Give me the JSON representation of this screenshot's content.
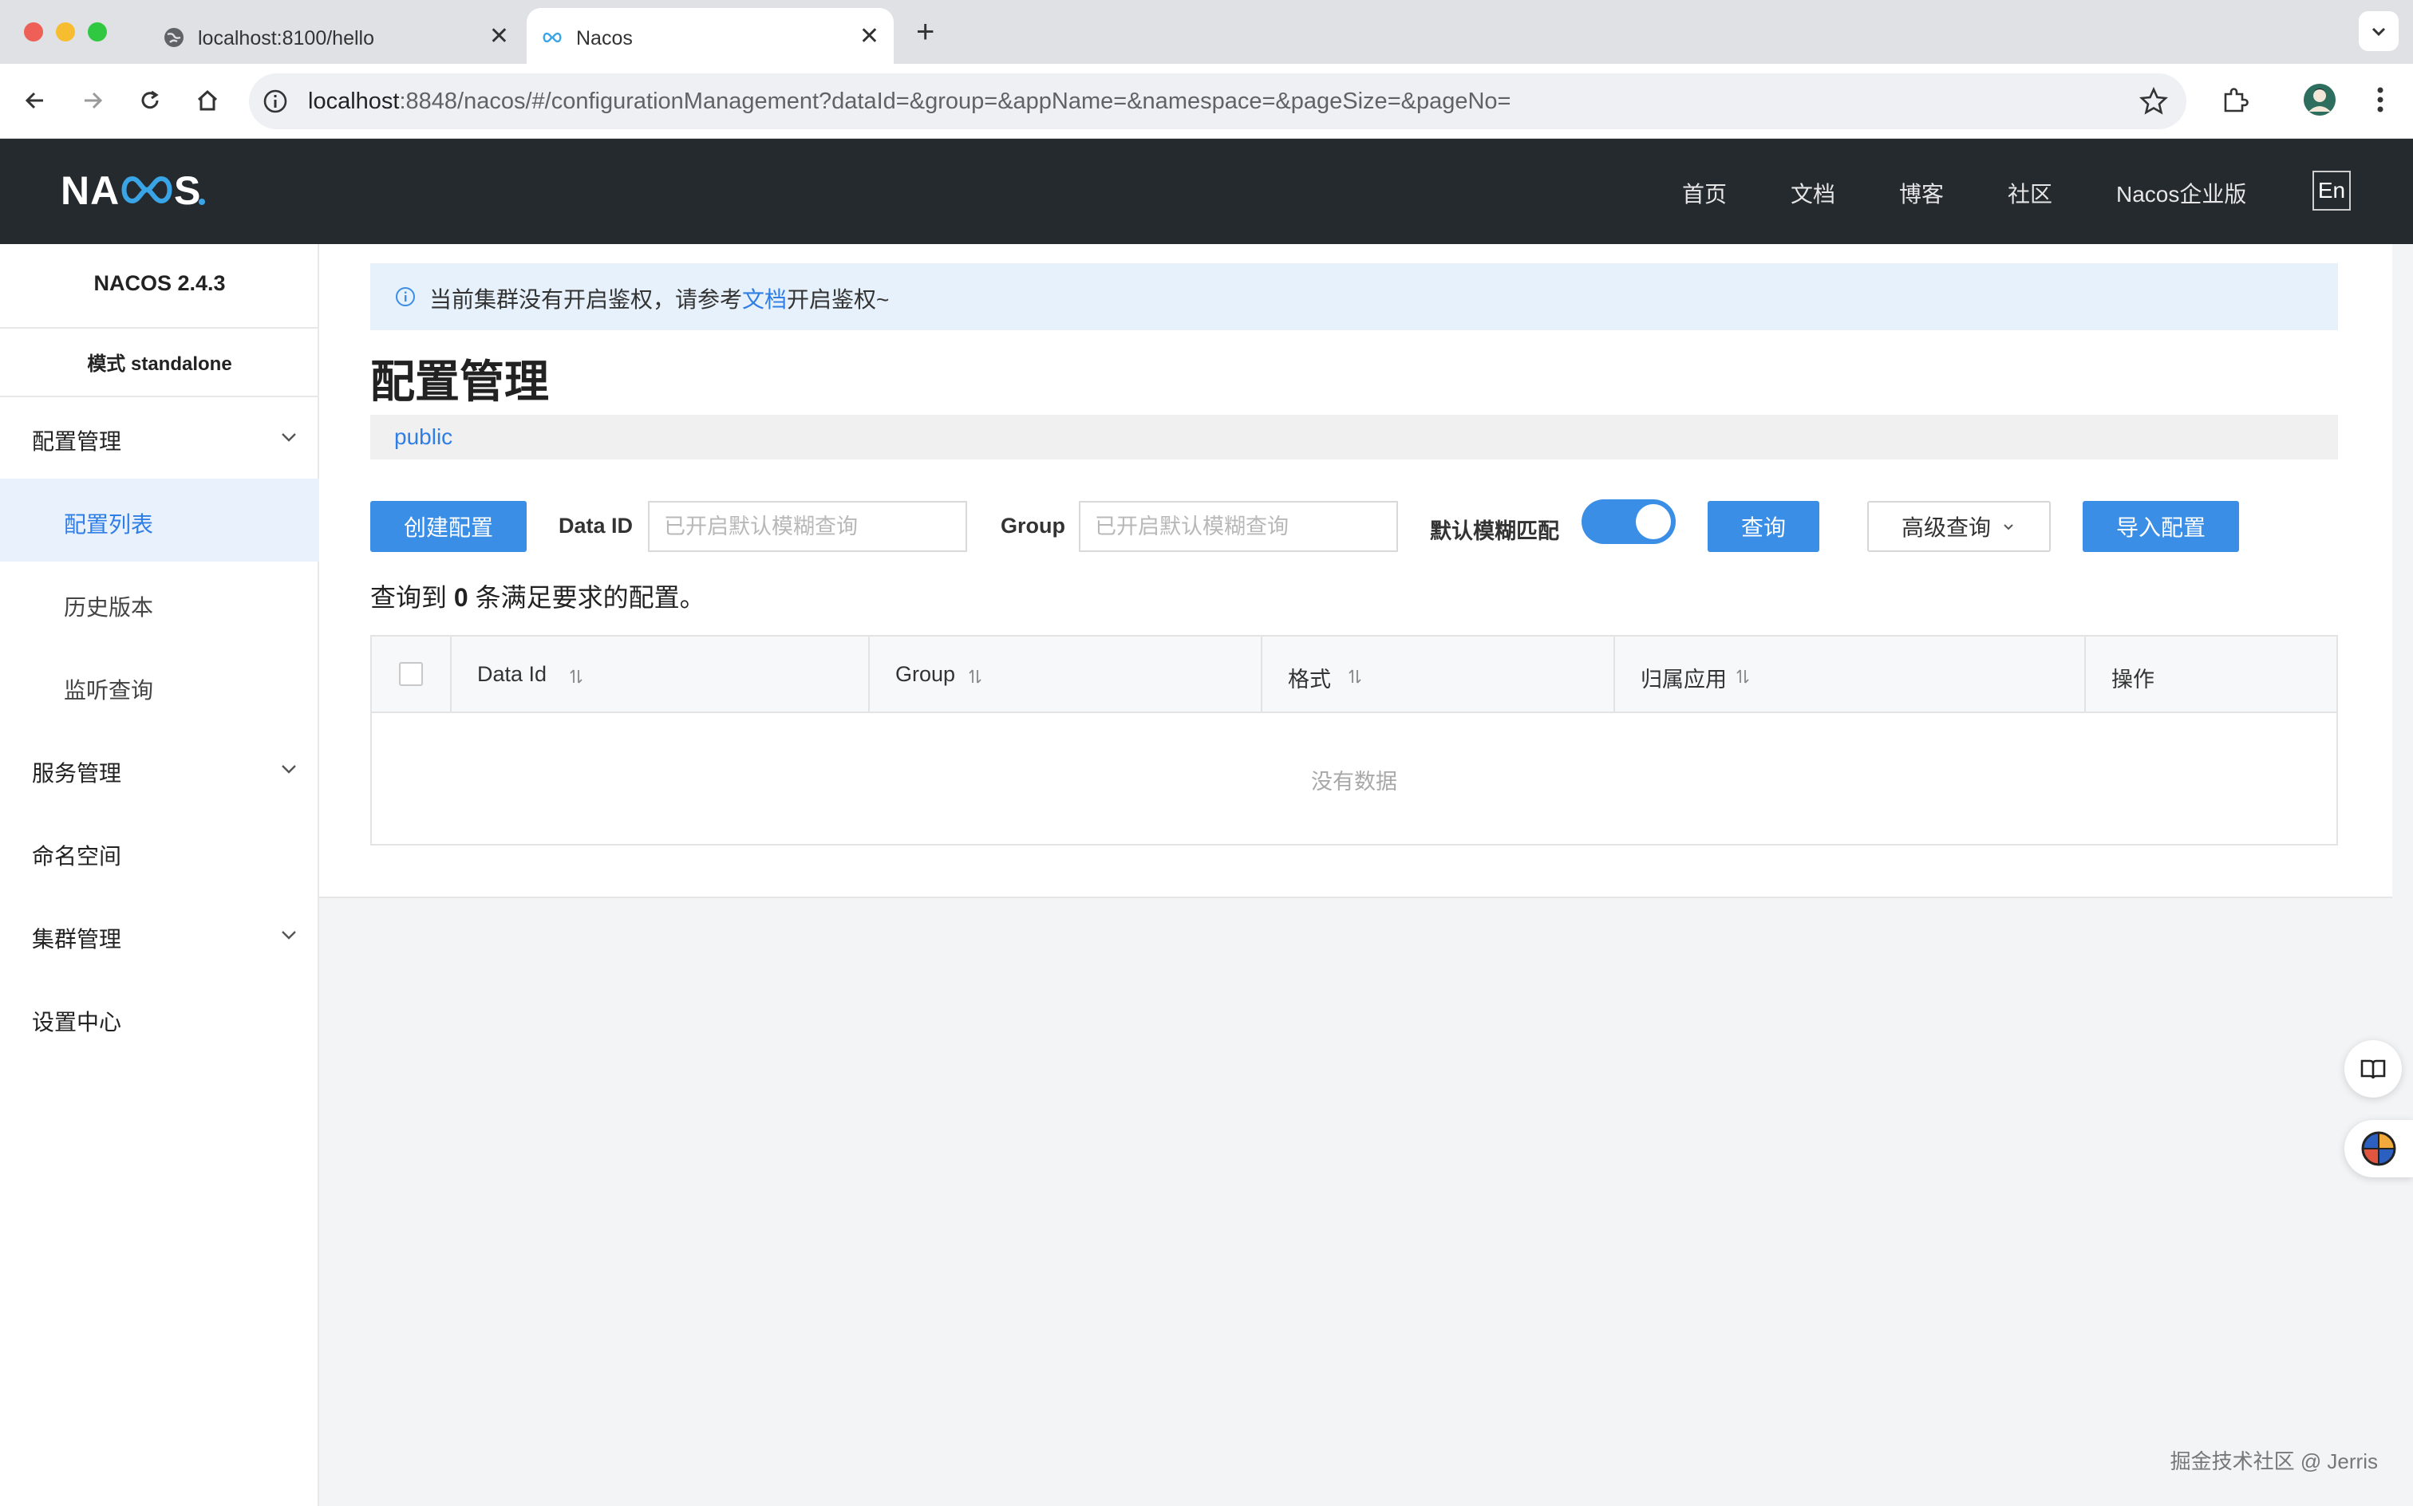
{
  "browser": {
    "tabs": [
      {
        "title": "localhost:8100/hello",
        "active": false
      },
      {
        "title": "Nacos",
        "active": true
      }
    ],
    "url_host": "localhost",
    "url_rest": ":8848/nacos/#/configurationManagement?dataId=&group=&appName=&namespace=&pageSize=&pageNo="
  },
  "header": {
    "logo": "NACOS.",
    "nav": [
      "首页",
      "文档",
      "博客",
      "社区",
      "Nacos企业版"
    ],
    "lang_button": "En"
  },
  "sidebar": {
    "version": "NACOS 2.4.3",
    "mode": "模式 standalone",
    "items": [
      {
        "label": "配置管理",
        "expandable": true
      },
      {
        "label": "配置列表",
        "sub": true,
        "active": true
      },
      {
        "label": "历史版本",
        "sub": true
      },
      {
        "label": "监听查询",
        "sub": true
      },
      {
        "label": "服务管理",
        "expandable": true
      },
      {
        "label": "命名空间"
      },
      {
        "label": "集群管理",
        "expandable": true
      },
      {
        "label": "设置中心"
      }
    ]
  },
  "notice": {
    "before": "当前集群没有开启鉴权，请参考",
    "link": "文档",
    "after": "开启鉴权~"
  },
  "page": {
    "title": "配置管理",
    "namespace": "public"
  },
  "filters": {
    "create_button": "创建配置",
    "data_id_label": "Data ID",
    "data_id_placeholder": "已开启默认模糊查询",
    "data_id_value": "",
    "group_label": "Group",
    "group_placeholder": "已开启默认模糊查询",
    "group_value": "",
    "fuzzy_label": "默认模糊匹配",
    "fuzzy_enabled": true,
    "search_button": "查询",
    "advanced_button": "高级查询",
    "import_button": "导入配置"
  },
  "result": {
    "prefix": "查询到",
    "count": "0",
    "suffix": "条满足要求的配置。"
  },
  "table": {
    "columns": [
      "Data Id",
      "Group",
      "格式",
      "归属应用",
      "操作"
    ],
    "rows": [],
    "empty_text": "没有数据"
  },
  "watermark": "掘金技术社区 @ Jerris",
  "colors": {
    "primary": "#3a8ee6",
    "header_bg": "#252a2f",
    "active_bg": "#e8f1fc",
    "notice_bg": "#e6f1fb"
  }
}
